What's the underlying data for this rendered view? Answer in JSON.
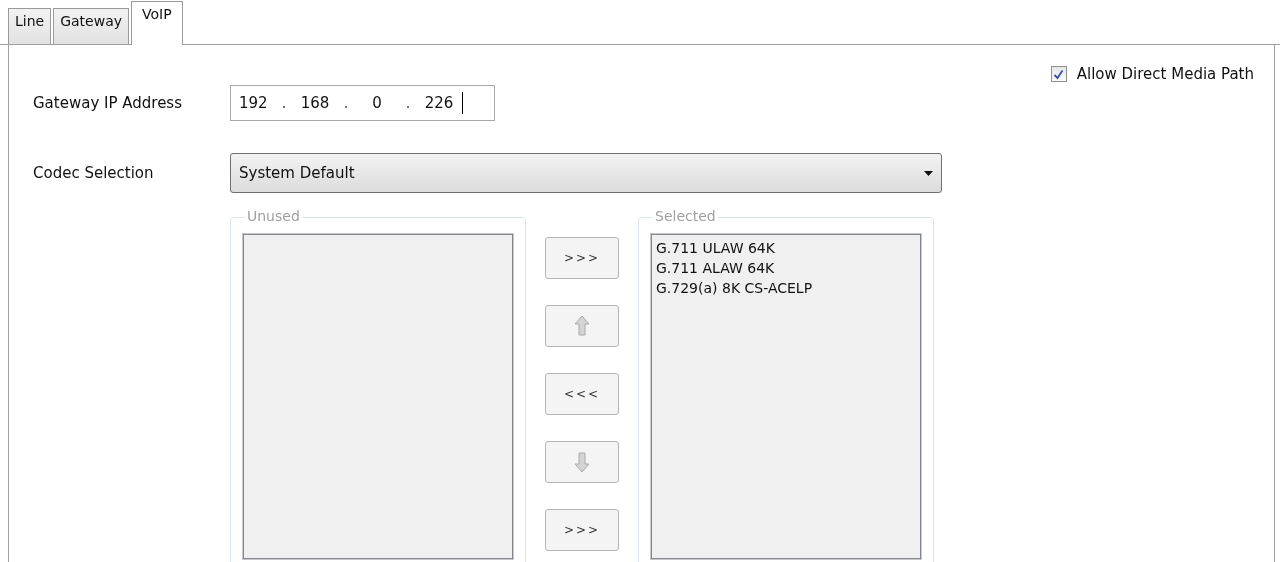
{
  "tabs": [
    {
      "label": "Line",
      "selected": false
    },
    {
      "label": "Gateway",
      "selected": false
    },
    {
      "label": "VoIP",
      "selected": true
    }
  ],
  "gateway_ip": {
    "label": "Gateway IP Address",
    "octets": [
      "192",
      "168",
      "0",
      "226"
    ]
  },
  "allow_direct_media_path": {
    "label": "Allow Direct Media Path",
    "checked": true
  },
  "codec_selection": {
    "label": "Codec Selection",
    "value": "System Default"
  },
  "unused": {
    "title": "Unused"
  },
  "transfer_buttons": [
    {
      "kind": "text",
      "label": ">>>",
      "disabled": false
    },
    {
      "kind": "up",
      "disabled": true
    },
    {
      "kind": "text",
      "label": "<<<",
      "disabled": false
    },
    {
      "kind": "down",
      "disabled": true
    },
    {
      "kind": "text",
      "label": ">>>",
      "disabled": false
    }
  ],
  "selected": {
    "title": "Selected",
    "items": [
      "G.711 ULAW 64K",
      "G.711 ALAW 64K",
      "G.729(a) 8K CS-ACELP"
    ]
  }
}
